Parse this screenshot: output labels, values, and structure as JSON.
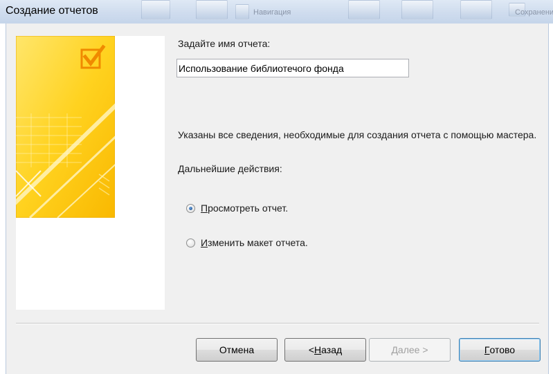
{
  "window": {
    "title": "Создание отчетов",
    "background_ribbon_text": [
      "Навигация",
      "Сохранение"
    ]
  },
  "report_name": {
    "label": "Задайте имя отчета:",
    "value": "Использование библиотечого фонда"
  },
  "info": {
    "text": "Указаны все сведения, необходимые для создания отчета с помощью мастера.",
    "next_actions_label": "Дальнейшие действия:"
  },
  "options": [
    {
      "label": "Просмотреть отчет.",
      "accel": "П",
      "rest": "росмотреть отчет.",
      "checked": true
    },
    {
      "label": "Изменить макет отчета.",
      "accel": "И",
      "rest": "зменить макет отчета.",
      "checked": false
    }
  ],
  "buttons": {
    "cancel": "Отмена",
    "back": "< Назад",
    "back_prefix": "< ",
    "back_accel": "Н",
    "back_rest": "азад",
    "next": "Далее >",
    "finish": "Готово",
    "finish_accel": "Г",
    "finish_rest": "отово"
  },
  "colors": {
    "wizard_art_yellow": "#ffd21f",
    "accent_orange": "#f5a623",
    "dialog_bg": "#f0f0f0"
  }
}
